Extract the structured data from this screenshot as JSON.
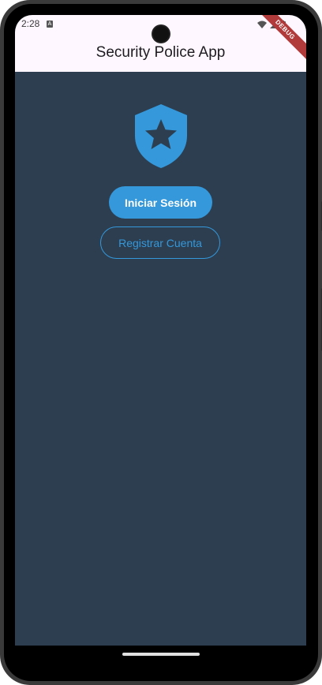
{
  "status_bar": {
    "time": "2:28",
    "notification_icon": "A",
    "icons": [
      "wifi-icon",
      "signal-icon",
      "battery-icon"
    ]
  },
  "debug_banner": "DEBUG",
  "app_bar": {
    "title": "Security Police App"
  },
  "main": {
    "logo_icon": "shield-star-icon",
    "login_button": "Iniciar Sesión",
    "register_button": "Registrar Cuenta"
  },
  "colors": {
    "background": "#2c3e50",
    "accent": "#3498db",
    "app_bar": "#fef7ff"
  }
}
